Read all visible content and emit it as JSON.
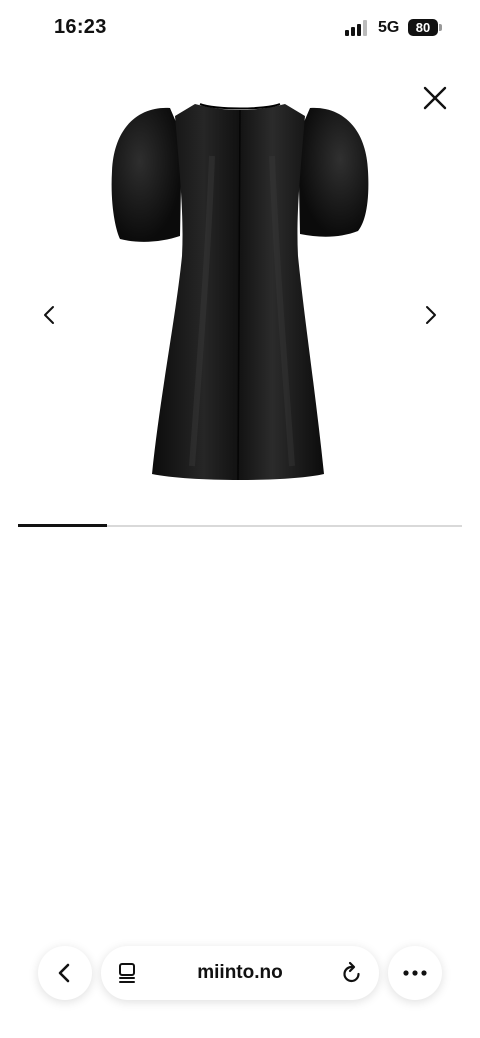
{
  "status_bar": {
    "time": "16:23",
    "network": "5G",
    "battery": "80"
  },
  "gallery": {
    "image_alt_icon": "dress-image",
    "current_index": 1,
    "image_count": 5,
    "progress_fraction": 0.2
  },
  "browser": {
    "url": "miinto.no"
  },
  "colors": {
    "accent": "#111111",
    "track": "#d9d9d9",
    "dress": "#141414"
  }
}
